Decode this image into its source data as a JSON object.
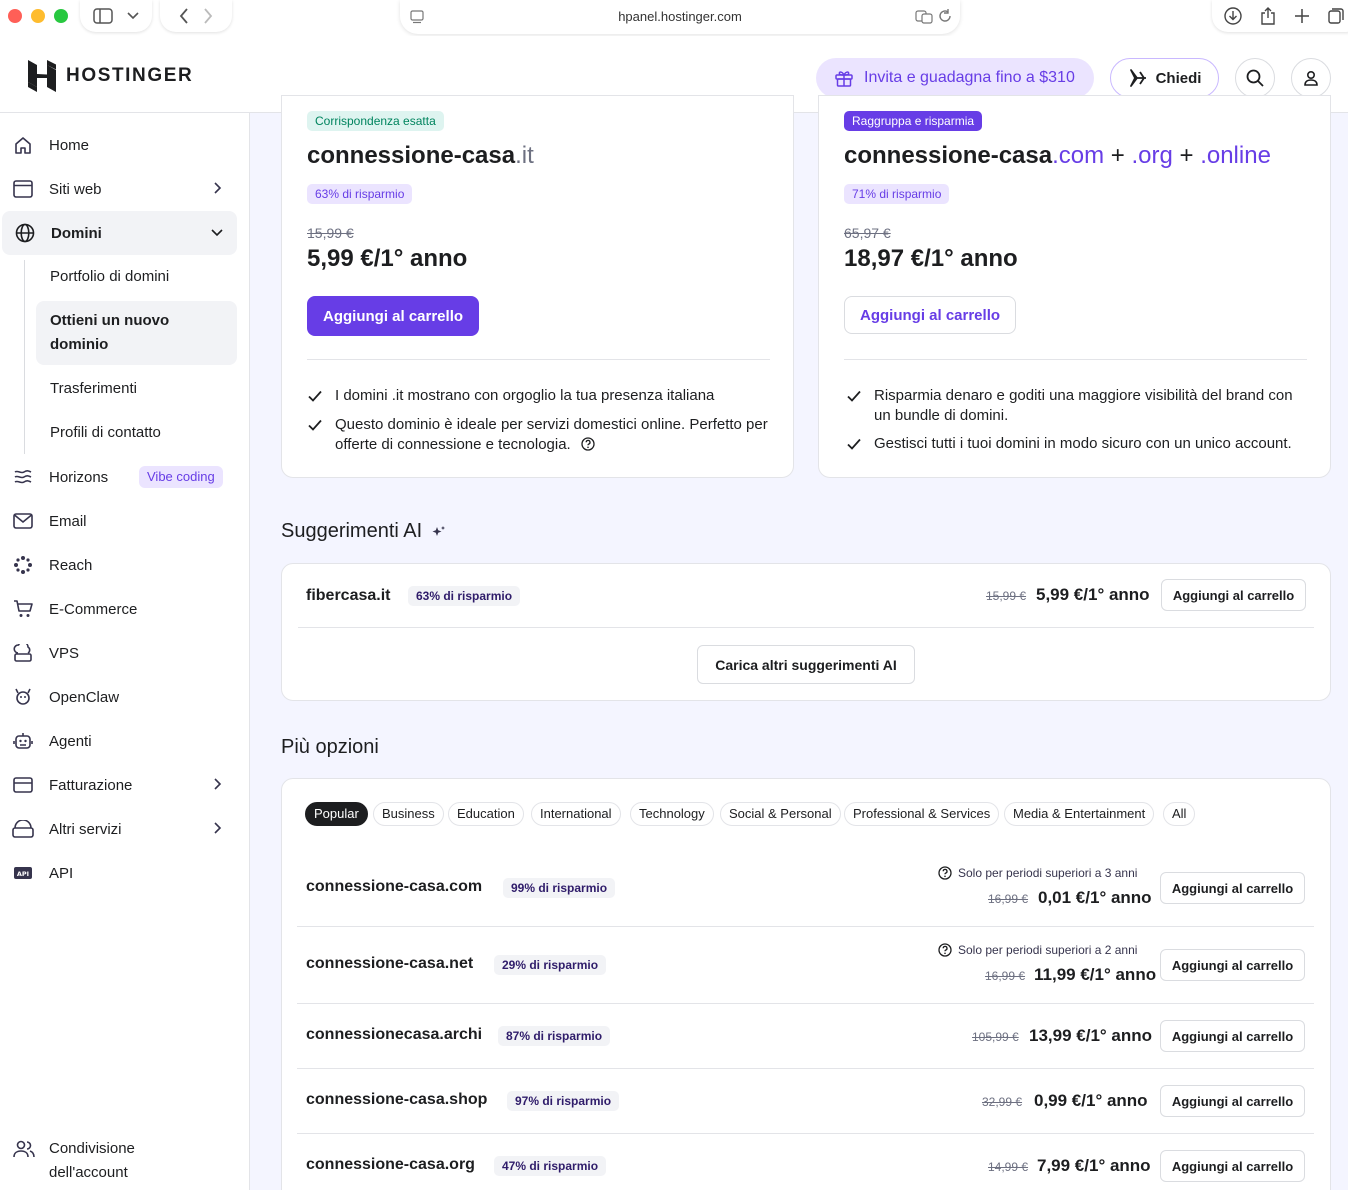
{
  "browser": {
    "url": "hpanel.hostinger.com"
  },
  "header": {
    "brand": "HOSTINGER",
    "invite_label": "Invita e guadagna fino a $310",
    "ask_label": "Chiedi"
  },
  "sidebar": {
    "items": [
      {
        "label": "Home",
        "icon": "home-icon"
      },
      {
        "label": "Siti web",
        "icon": "browser-icon"
      },
      {
        "label": "Domini",
        "icon": "globe-icon"
      },
      {
        "label": "Horizons",
        "icon": "horizons-icon",
        "badge": "Vibe coding"
      },
      {
        "label": "Email",
        "icon": "mail-icon"
      },
      {
        "label": "Reach",
        "icon": "reach-icon"
      },
      {
        "label": "E-Commerce",
        "icon": "cart-icon"
      },
      {
        "label": "VPS",
        "icon": "cloud-server-icon"
      },
      {
        "label": "OpenClaw",
        "icon": "claw-icon"
      },
      {
        "label": "Agenti",
        "icon": "robot-icon"
      },
      {
        "label": "Fatturazione",
        "icon": "card-icon"
      },
      {
        "label": "Altri servizi",
        "icon": "services-icon"
      },
      {
        "label": "API",
        "icon": "api-icon"
      }
    ],
    "domini_sub": [
      "Portfolio di domini",
      "Ottieni un nuovo dominio",
      "Trasferimenti",
      "Profili di contatto"
    ],
    "footer_label": "Condivisione dell'account"
  },
  "exact_card": {
    "tag": "Corrispondenza esatta",
    "domain_base": "connessione-casa",
    "domain_tld": ".it",
    "saving": "63% di risparmio",
    "old_price": "15,99 €",
    "price": "5,99 €/1° anno",
    "button": "Aggiungi al carrello",
    "features": [
      "I domini .it mostrano con orgoglio la tua presenza italiana",
      "Questo dominio è ideale per servizi domestici online. Perfetto per offerte di connessione e tecnologia."
    ]
  },
  "bundle_card": {
    "tag": "Raggruppa e risparmia",
    "domain_base": "connessione-casa",
    "tlds": [
      ".com",
      ".org",
      ".online"
    ],
    "plus": "+",
    "saving": "71% di risparmio",
    "old_price": "65,97 €",
    "price": "18,97 €/1° anno",
    "button": "Aggiungi al carrello",
    "features": [
      "Risparmia denaro e goditi una maggiore visibilità del brand con un bundle di domini.",
      "Gestisci tutti i tuoi domini in modo sicuro con un unico account."
    ]
  },
  "ai_section": {
    "title": "Suggerimenti AI",
    "row": {
      "name": "fibercasa.it",
      "saving": "63% di risparmio",
      "old_price": "15,99 €",
      "price": "5,99 €/1° anno",
      "button": "Aggiungi al carrello"
    },
    "load_more": "Carica altri suggerimenti AI"
  },
  "more_section": {
    "title": "Più opzioni",
    "chips": [
      "Popular",
      "Business",
      "Education",
      "International",
      "Technology",
      "Social & Personal",
      "Professional & Services",
      "Media & Entertainment",
      "All"
    ],
    "rows": [
      {
        "name": "connessione-casa.com",
        "saving": "99% di risparmio",
        "note": "Solo per periodi superiori a 3 anni",
        "old_price": "16,99 €",
        "price": "0,01 €/1° anno",
        "button": "Aggiungi al carrello"
      },
      {
        "name": "connessione-casa.net",
        "saving": "29% di risparmio",
        "note": "Solo per periodi superiori a 2 anni",
        "old_price": "16,99 €",
        "price": "11,99 €/1° anno",
        "button": "Aggiungi al carrello"
      },
      {
        "name": "connessionecasa.archi",
        "saving": "87% di risparmio",
        "old_price": "105,99 €",
        "price": "13,99 €/1° anno",
        "button": "Aggiungi al carrello"
      },
      {
        "name": "connessione-casa.shop",
        "saving": "97% di risparmio",
        "old_price": "32,99 €",
        "price": "0,99 €/1° anno",
        "button": "Aggiungi al carrello"
      },
      {
        "name": "connessione-casa.org",
        "saving": "47% di risparmio",
        "old_price": "14,99 €",
        "price": "7,99 €/1° anno",
        "button": "Aggiungi al carrello"
      }
    ]
  },
  "colors": {
    "accent": "#673de6",
    "accent_light": "#ebe4ff",
    "success": "#00845e",
    "text": "#1d1e20"
  }
}
